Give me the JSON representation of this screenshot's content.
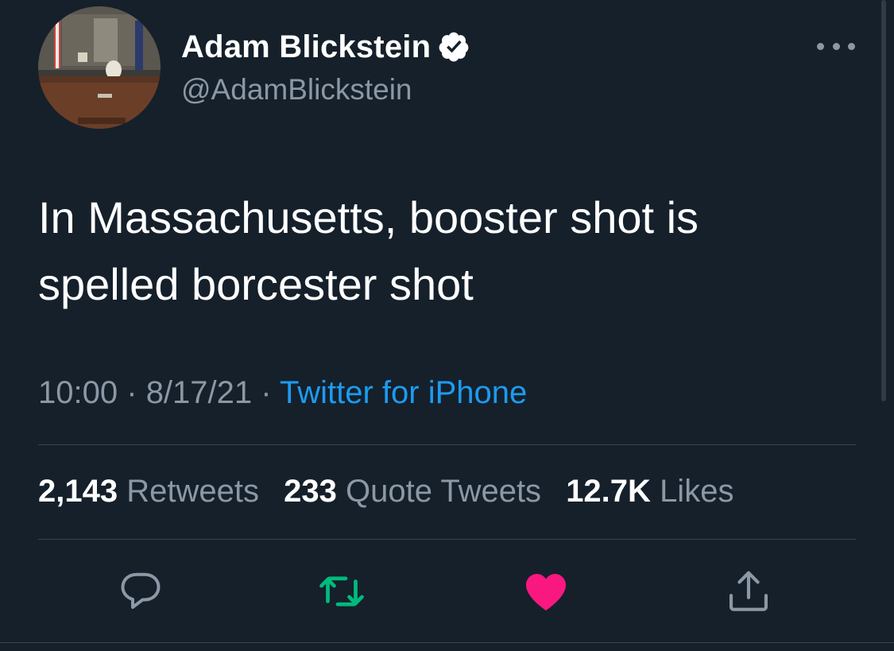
{
  "author": {
    "display_name": "Adam Blickstein",
    "handle": "@AdamBlickstein",
    "verified": true
  },
  "tweet": {
    "text": "In Massachusetts, booster shot is spelled borcester shot",
    "time": "10:00",
    "date": "8/17/21",
    "separator": "·",
    "source": "Twitter for iPhone"
  },
  "stats": {
    "retweets_count": "2,143",
    "retweets_label": "Retweets",
    "quotes_count": "233",
    "quotes_label": "Quote Tweets",
    "likes_count": "12.7K",
    "likes_label": "Likes"
  },
  "actions": [
    "reply-icon",
    "retweet-icon",
    "like-icon",
    "share-icon"
  ],
  "colors": {
    "background": "#15202b",
    "text_primary": "#ffffff",
    "text_secondary": "#8b98a5",
    "link": "#1d9bf0",
    "retweet_active": "#00ba7c",
    "like_active": "#f91880",
    "divider": "#38444d"
  }
}
